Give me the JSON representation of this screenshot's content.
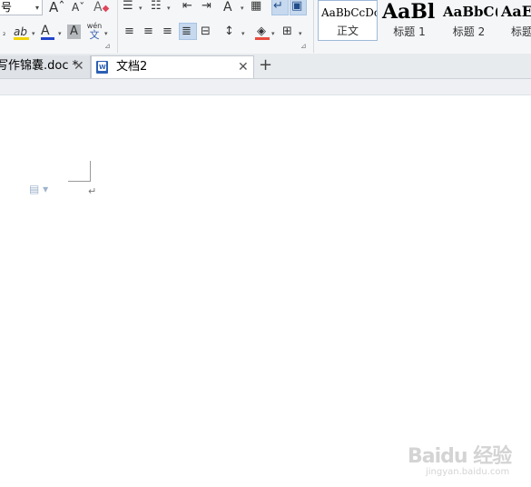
{
  "ribbon": {
    "font_size_value": "号",
    "grow_font_icon": "Aˆ",
    "shrink_font_icon": "Aˇ",
    "clear_format_icon": "A",
    "highlight_icon": "ab",
    "font_color_icon": "A",
    "char_shading_icon": "A",
    "phonetic_top": "wén",
    "phonetic_bottom": "文",
    "text_effects_icon": "A",
    "style_gallery": [
      {
        "sample": "AaBbCcDc",
        "name": "正文"
      },
      {
        "sample": "AaBl",
        "name": "标题 1"
      },
      {
        "sample": "AaBbC(",
        "name": "标题 2"
      },
      {
        "sample": "AaE",
        "name": "标题"
      }
    ]
  },
  "tabs": [
    {
      "title": "写作锦囊.doc *",
      "close": "✕"
    },
    {
      "title": "文档2",
      "close": "✕"
    }
  ],
  "new_tab": "+",
  "document": {
    "paragraph_mark": "↵",
    "para_widget": "▤ ▾"
  },
  "watermark": {
    "brand": "Baidu 经验",
    "url": "jingyan.baidu.com"
  }
}
